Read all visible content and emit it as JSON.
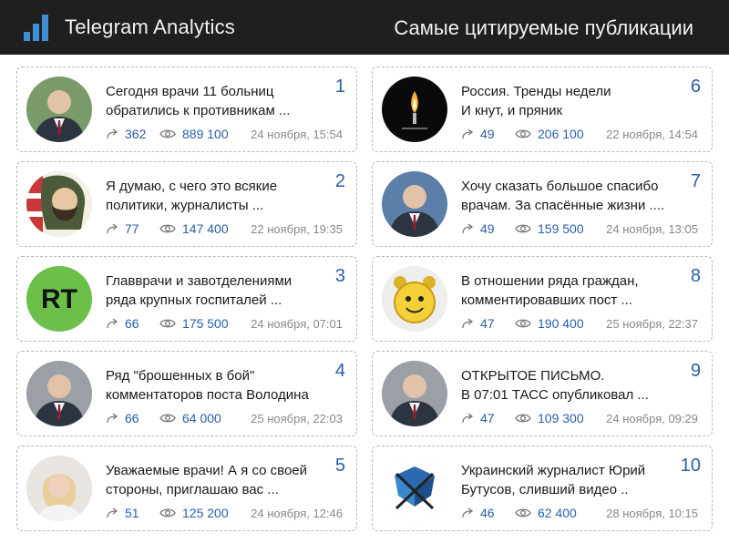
{
  "header": {
    "app_title": "Telegram Analytics",
    "section_title": "Самые цитируемые публикации",
    "logo_icon": "bar-chart-icon",
    "accent_color": "#3f8fd9"
  },
  "cards": [
    {
      "rank": "1",
      "line1": "Сегодня врачи 11 больниц",
      "line2": "обратились к противникам ...",
      "shares": "362",
      "views": "889 100",
      "date": "24 ноября, 15:54",
      "avatar_icon": "man-portrait-icon"
    },
    {
      "rank": "2",
      "line1": "Я думаю, с чего это всякие",
      "line2": "политики, журналисты ...",
      "shares": "77",
      "views": "147 400",
      "date": "22 ноября, 19:35",
      "avatar_icon": "cartoon-face-icon"
    },
    {
      "rank": "3",
      "line1": "Главврачи и завотделениями",
      "line2": "ряда крупных госпиталей ...",
      "shares": "66",
      "views": "175 500",
      "date": "24 ноября, 07:01",
      "avatar_icon": "rt-logo-icon",
      "avatar_text": "RT"
    },
    {
      "rank": "4",
      "line1": "Ряд \"брошенных в бой\"",
      "line2": "комментаторов поста Володина",
      "shares": "66",
      "views": "64 000",
      "date": "25 ноября, 22:03",
      "avatar_icon": "man-portrait-icon"
    },
    {
      "rank": "5",
      "line1": "Уважаемые врачи! А я со своей",
      "line2": "стороны, приглашаю вас ...",
      "shares": "51",
      "views": "125 200",
      "date": "24 ноября, 12:46",
      "avatar_icon": "woman-portrait-icon"
    },
    {
      "rank": "6",
      "line1": "Россия. Тренды недели",
      "line2": "И кнут, и пряник",
      "shares": "49",
      "views": "206 100",
      "date": "22 ноября, 14:54",
      "avatar_icon": "candle-icon"
    },
    {
      "rank": "7",
      "line1": "Хочу сказать большое спасибо",
      "line2": "врачам. За спасённые жизни ....",
      "shares": "49",
      "views": "159 500",
      "date": "24 ноября, 13:05",
      "avatar_icon": "man-portrait-icon"
    },
    {
      "rank": "8",
      "line1": "В отношении ряда граждан,",
      "line2": "комментировавших пост ...",
      "shares": "47",
      "views": "190 400",
      "date": "25 ноября, 22:37",
      "avatar_icon": "alarm-clock-icon"
    },
    {
      "rank": "9",
      "line1": "ОТКРЫТОЕ ПИСЬМО.",
      "line2": "В 07:01 ТАСС опубликовал ...",
      "shares": "47",
      "views": "109 300",
      "date": "24 ноября, 09:29",
      "avatar_icon": "man-portrait-icon"
    },
    {
      "rank": "10",
      "line1": "Украинский журналист Юрий",
      "line2": "Бутусов, сливший видео ..",
      "shares": "46",
      "views": "62 400",
      "date": "28 ноября, 10:15",
      "avatar_icon": "shield-emblem-icon"
    }
  ]
}
